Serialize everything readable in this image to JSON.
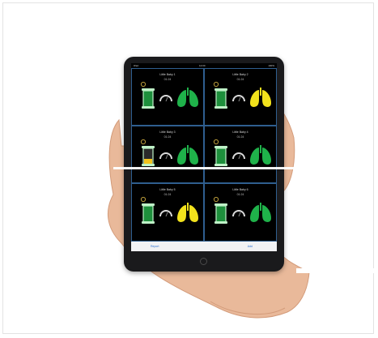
{
  "device": {
    "status_bar": {
      "carrier": "iPad",
      "time": "12:00",
      "battery": "100%"
    }
  },
  "monitors": [
    {
      "title": "Little Baby 1",
      "time": "01:24",
      "lung_status": "normal",
      "bar_level": "full"
    },
    {
      "title": "Little Baby 2",
      "time": "01:24",
      "lung_status": "warning",
      "bar_level": "full"
    },
    {
      "title": "Little Baby 3",
      "time": "01:24",
      "lung_status": "normal",
      "bar_level": "low"
    },
    {
      "title": "Little Baby 4",
      "time": "01:24",
      "lung_status": "normal",
      "bar_level": "full"
    },
    {
      "title": "Little Baby 5",
      "time": "01:24",
      "lung_status": "warning",
      "bar_level": "full"
    },
    {
      "title": "Little Baby 6",
      "time": "01:24",
      "lung_status": "normal",
      "bar_level": "full"
    }
  ],
  "bottom_bar": {
    "left_label": "Report",
    "right_label": "Add"
  },
  "colors": {
    "lung_normal": "#1fb24a",
    "lung_warning": "#f2e21c",
    "bar_outline": "#bff2c7",
    "bar_fill": "#1e8f3c",
    "bar_low": "#f2c31c",
    "cell_border": "#2f5e8f"
  }
}
